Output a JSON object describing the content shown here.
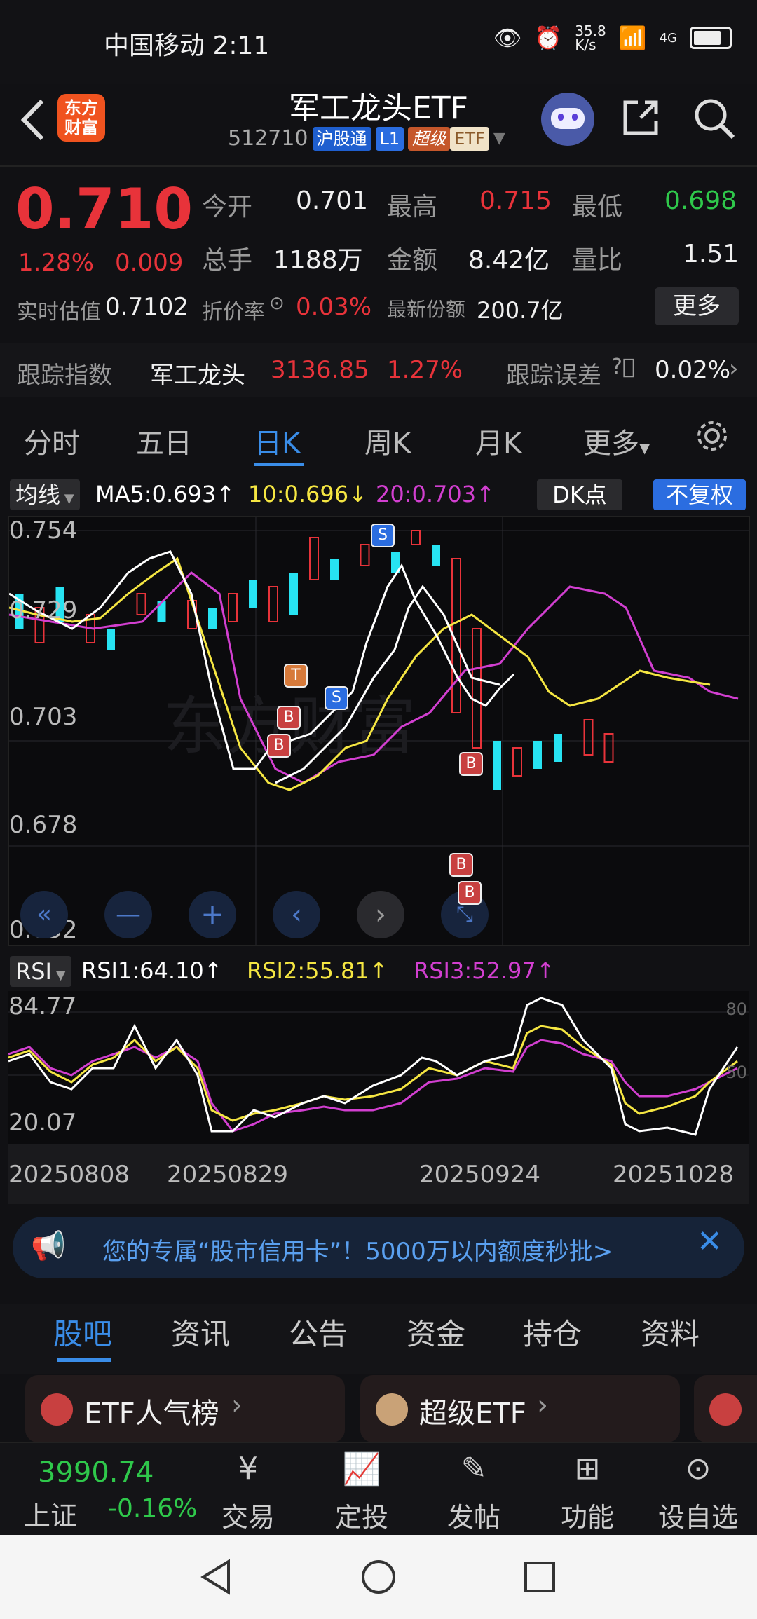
{
  "status_bar": {
    "carrier": "中国移动 2:11",
    "speed": "35.8\nK/s",
    "network": "4G"
  },
  "header": {
    "title": "军工龙头ETF",
    "code": "512710",
    "tags": [
      "沪股通",
      "L1",
      "超级",
      "ETF"
    ],
    "logo_text": "东方\n财富"
  },
  "quote": {
    "price": "0.710",
    "pct": "1.28%",
    "chg": "0.009",
    "open_label": "今开",
    "open": "0.701",
    "high_label": "最高",
    "high": "0.715",
    "low_label": "最低",
    "low": "0.698",
    "vol_label": "总手",
    "vol": "1188万",
    "amt_label": "金额",
    "amt": "8.42亿",
    "ratio_label": "量比",
    "ratio": "1.51",
    "iopv_label": "实时估值",
    "iopv": "0.7102",
    "prem_label": "折价率",
    "prem": "0.03%",
    "shares_label": "最新份额",
    "shares": "200.7亿",
    "more": "更多"
  },
  "tracking": {
    "label": "跟踪指数",
    "index_name": "军工龙头",
    "index_value": "3136.85",
    "index_pct": "1.27%",
    "err_label": "跟踪误差",
    "err": "0.02%"
  },
  "tabs": [
    "分时",
    "五日",
    "日K",
    "周K",
    "月K",
    "更多"
  ],
  "active_tab": "日K",
  "ma_bar": {
    "selector": "均线",
    "ma5": "MA5:0.693↑",
    "ma10": "10:0.696↓",
    "ma20": "20:0.703↑",
    "dk": "DK点",
    "fq": "不复权"
  },
  "kline_axis": [
    "0.754",
    "0.729",
    "0.703",
    "0.678",
    "0.652"
  ],
  "rsi_bar": {
    "selector": "RSI",
    "rsi1": "RSI1:64.10↑",
    "rsi2": "RSI2:55.81↑",
    "rsi3": "RSI3:52.97↑"
  },
  "rsi_axis": {
    "top": "84.77",
    "bottom": "20.07",
    "r80": "80",
    "r50": "50"
  },
  "dates": [
    "20250808",
    "20250829",
    "20250924",
    "20251028"
  ],
  "banner": {
    "text": "您的专属“股市信用卡”！5000万以内额度秒批>"
  },
  "lower_tabs": [
    "股吧",
    "资讯",
    "公告",
    "资金",
    "持仓",
    "资料"
  ],
  "cards": [
    {
      "label": "ETF人气榜"
    },
    {
      "label": "超级ETF"
    }
  ],
  "bottom": {
    "index_value": "3990.74",
    "index_name": "上证",
    "index_pct": "-0.16%",
    "items": [
      "交易",
      "定投",
      "发帖",
      "功能",
      "设自选"
    ]
  },
  "colors": {
    "up": "#e8333a",
    "down": "#2fc84b",
    "accent": "#3a8de8",
    "ma5": "#ffffff",
    "ma10": "#f5e642",
    "ma20": "#d23fd0",
    "cyan": "#27e3f2"
  }
}
